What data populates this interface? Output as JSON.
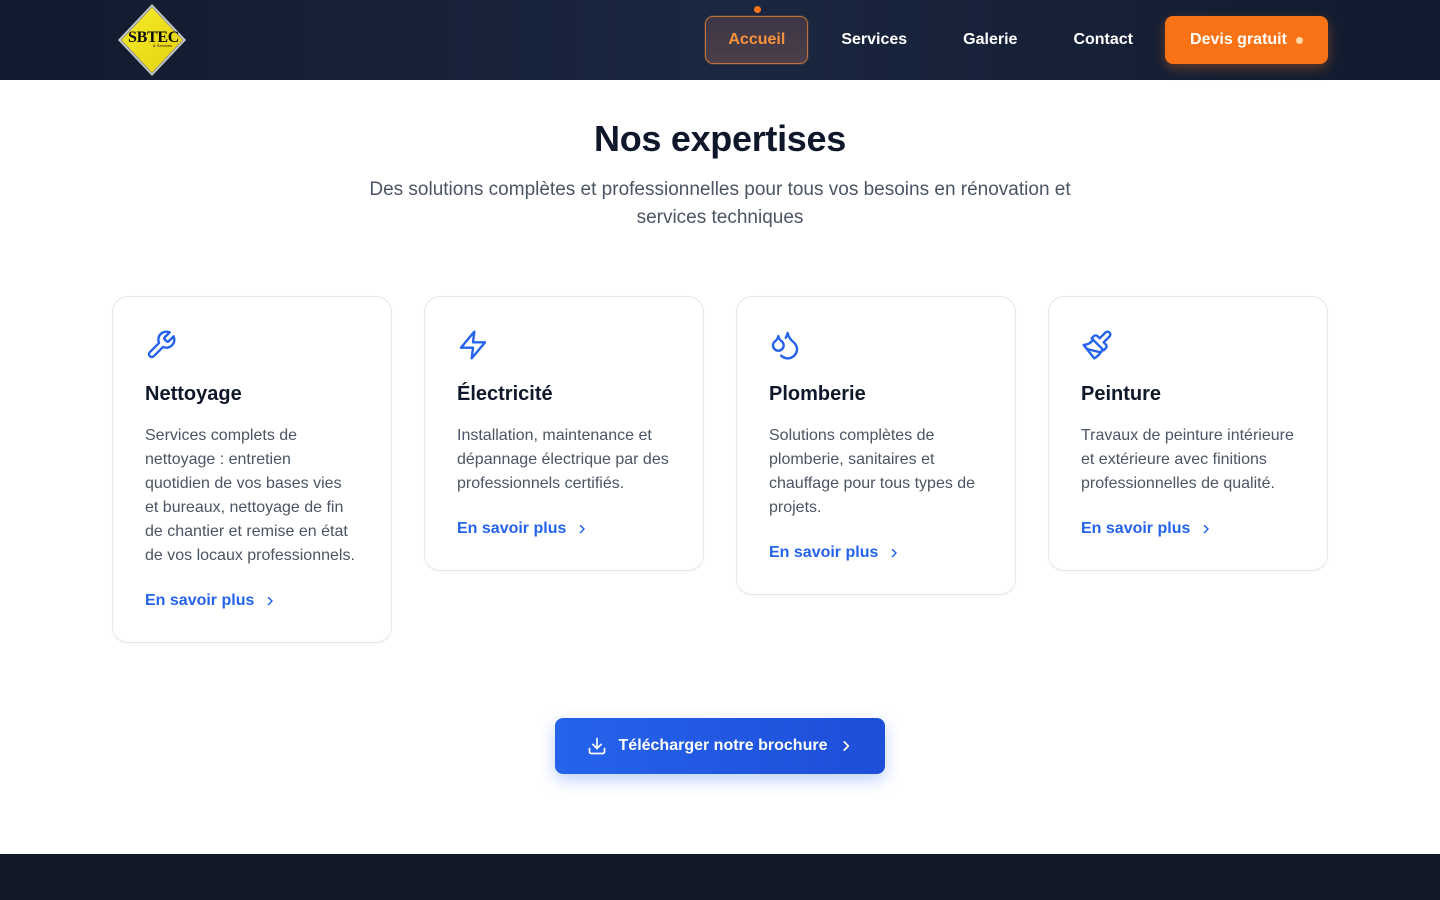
{
  "colors": {
    "header_bg": "#111a2e",
    "accent_orange": "#f97316",
    "accent_blue": "#2563eb",
    "text_dark": "#0f172a",
    "text_muted": "#4b5563",
    "logo_yellow": "#f2e21a",
    "footer_bg": "#111827"
  },
  "header": {
    "logo": {
      "text": "SBTEC",
      "sub": "& Services",
      "icon": "diamond-logo"
    },
    "nav": [
      {
        "label": "Accueil",
        "active": true
      },
      {
        "label": "Services",
        "active": false
      },
      {
        "label": "Galerie",
        "active": false
      },
      {
        "label": "Contact",
        "active": false
      }
    ],
    "cta": {
      "label": "Devis gratuit"
    }
  },
  "section": {
    "title": "Nos expertises",
    "subtitle": "Des solutions complètes et professionnelles pour tous vos besoins en rénovation et services techniques"
  },
  "cards": [
    {
      "icon": "wrench-icon",
      "title": "Nettoyage",
      "description": "Services complets de nettoyage : entretien quotidien de vos bases vies et bureaux, nettoyage de fin de chantier et remise en état de vos locaux professionnels.",
      "link": "En savoir plus"
    },
    {
      "icon": "lightning-icon",
      "title": "Électricité",
      "description": "Installation, maintenance et dépannage électrique par des professionnels certifiés.",
      "link": "En savoir plus"
    },
    {
      "icon": "droplets-icon",
      "title": "Plomberie",
      "description": "Solutions complètes de plomberie, sanitaires et chauffage pour tous types de projets.",
      "link": "En savoir plus"
    },
    {
      "icon": "paintbrush-icon",
      "title": "Peinture",
      "description": "Travaux de peinture intérieure et extérieure avec finitions professionnelles de qualité.",
      "link": "En savoir plus"
    }
  ],
  "brochure": {
    "label": "Télécharger notre brochure"
  }
}
